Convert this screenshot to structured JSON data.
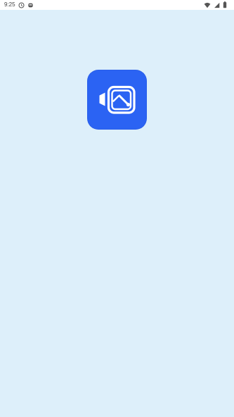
{
  "status_bar": {
    "time": "9:25",
    "left_icons": [
      "clock-icon",
      "notification-icon"
    ],
    "right_icons": [
      "wifi-icon",
      "signal-icon",
      "battery-icon"
    ]
  },
  "app": {
    "icon_name": "screen-recorder-icon",
    "accent_color": "#2b63f3",
    "background_color": "#ddeffa"
  }
}
